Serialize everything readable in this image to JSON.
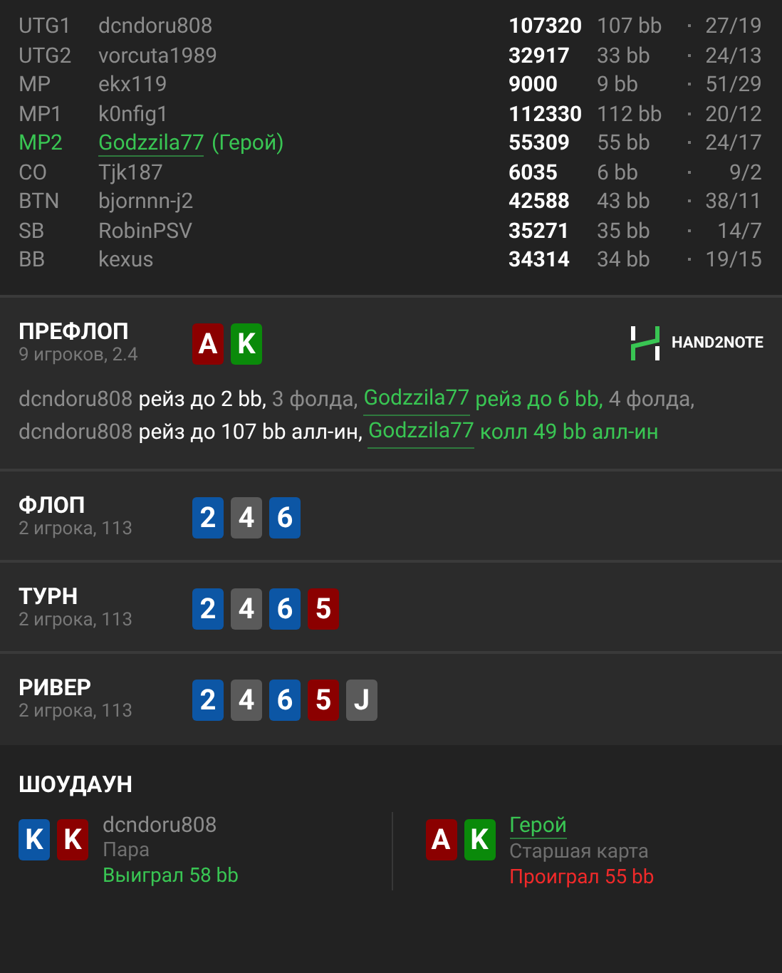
{
  "players": [
    {
      "position": "UTG1",
      "name": "dcndoru808",
      "hero": false,
      "stack": "107320",
      "bb": "107 bb",
      "stats": "27/19"
    },
    {
      "position": "UTG2",
      "name": "vorcuta1989",
      "hero": false,
      "stack": "32917",
      "bb": "33 bb",
      "stats": "24/13"
    },
    {
      "position": "MP",
      "name": "ekx119",
      "hero": false,
      "stack": "9000",
      "bb": "9 bb",
      "stats": "51/29"
    },
    {
      "position": "MP1",
      "name": "k0nfig1",
      "hero": false,
      "stack": "112330",
      "bb": "112 bb",
      "stats": "20/12"
    },
    {
      "position": "MP2",
      "name": "Godzzila77",
      "hero": true,
      "hero_tag": "(Герой)",
      "stack": "55309",
      "bb": "55 bb",
      "stats": "24/17"
    },
    {
      "position": "CO",
      "name": "Tjk187",
      "hero": false,
      "stack": "6035",
      "bb": "6 bb",
      "stats": "9/2"
    },
    {
      "position": "BTN",
      "name": "bjornnn-j2",
      "hero": false,
      "stack": "42588",
      "bb": "43 bb",
      "stats": "38/11"
    },
    {
      "position": "SB",
      "name": "RobinPSV",
      "hero": false,
      "stack": "35271",
      "bb": "35 bb",
      "stats": "14/7"
    },
    {
      "position": "BB",
      "name": "kexus",
      "hero": false,
      "stack": "34314",
      "bb": "34 bb",
      "stats": "19/15"
    }
  ],
  "streets": [
    {
      "title": "ПРЕФЛОП",
      "info": "9 игроков, 2.4",
      "logo": "HAND2NOTE",
      "cards": [
        {
          "rank": "A",
          "color": "#8b0000"
        },
        {
          "rank": "K",
          "color": "#0a8a0a"
        }
      ],
      "actions": [
        [
          {
            "kind": "player",
            "text": "dcndoru808"
          },
          {
            "kind": "action",
            "text": "рейз до 2 bb,"
          },
          {
            "kind": "muted",
            "text": "3 фолда,"
          },
          {
            "kind": "hero",
            "text": "Godzzila77"
          },
          {
            "kind": "hero_action",
            "text": "рейз до 6 bb,"
          },
          {
            "kind": "muted",
            "text": "4 фолда,"
          }
        ],
        [
          {
            "kind": "player",
            "text": "dcndoru808"
          },
          {
            "kind": "action",
            "text": "рейз до 107 bb алл-ин,"
          },
          {
            "kind": "hero",
            "text": "Godzzila77"
          },
          {
            "kind": "hero_action",
            "text": "колл 49 bb алл-ин"
          }
        ]
      ]
    },
    {
      "title": "ФЛОП",
      "info": "2 игрока, 113",
      "cards": [
        {
          "rank": "2",
          "color": "#0c56a5"
        },
        {
          "rank": "4",
          "color": "#5a5a5a"
        },
        {
          "rank": "6",
          "color": "#0c56a5"
        }
      ]
    },
    {
      "title": "ТУРН",
      "info": "2 игрока, 113",
      "cards": [
        {
          "rank": "2",
          "color": "#0c56a5"
        },
        {
          "rank": "4",
          "color": "#5a5a5a"
        },
        {
          "rank": "6",
          "color": "#0c56a5"
        },
        {
          "rank": "5",
          "color": "#8b0000"
        }
      ]
    },
    {
      "title": "РИВЕР",
      "info": "2 игрока, 113",
      "cards": [
        {
          "rank": "2",
          "color": "#0c56a5"
        },
        {
          "rank": "4",
          "color": "#5a5a5a"
        },
        {
          "rank": "6",
          "color": "#0c56a5"
        },
        {
          "rank": "5",
          "color": "#8b0000"
        },
        {
          "rank": "J",
          "color": "#5a5a5a"
        }
      ]
    }
  ],
  "showdown": {
    "title": "ШОУДАУН",
    "hands": [
      {
        "name": "dcndoru808",
        "hero": false,
        "combo": "Пара",
        "result": "Выиграл 58 bb",
        "won": true,
        "cards": [
          {
            "rank": "K",
            "color": "#0c56a5"
          },
          {
            "rank": "K",
            "color": "#8b0000"
          }
        ]
      },
      {
        "name": "Герой",
        "hero": true,
        "combo": "Старшая карта",
        "result": "Проиграл 55 bb",
        "won": false,
        "cards": [
          {
            "rank": "A",
            "color": "#8b0000"
          },
          {
            "rank": "K",
            "color": "#0a8a0a"
          }
        ]
      }
    ]
  }
}
